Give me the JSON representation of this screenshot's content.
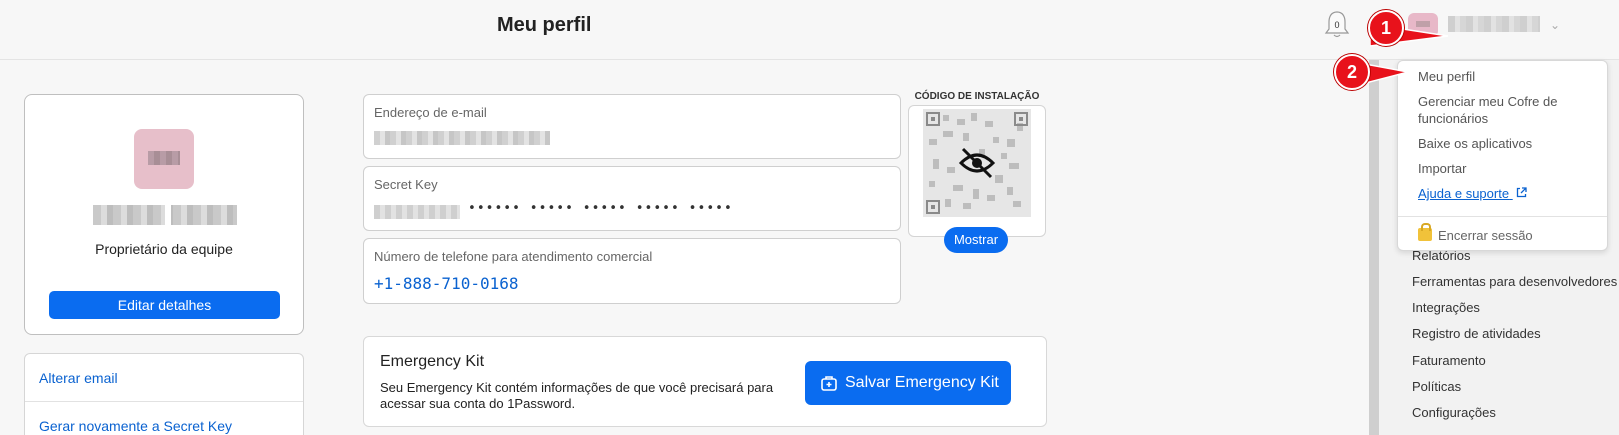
{
  "header": {
    "title": "Meu perfil",
    "notification_count": "0"
  },
  "callouts": [
    "1",
    "2"
  ],
  "profile": {
    "role": "Proprietário da equipe",
    "edit_label": "Editar detalhes"
  },
  "account_links": [
    "Alterar email",
    "Gerar novamente a Secret Key"
  ],
  "fields": {
    "email_label": "Endereço de e-mail",
    "secret_key_label": "Secret Key",
    "secret_key_masked": "•••••• ••••• ••••• ••••• •••••",
    "phone_label": "Número de telefone para atendimento comercial",
    "phone_value": "+1-888-710-0168"
  },
  "install_code": {
    "title": "CÓDIGO DE INSTALAÇÃO",
    "show_label": "Mostrar"
  },
  "emergency_kit": {
    "title": "Emergency Kit",
    "description": "Seu Emergency Kit contém informações de que você precisará para acessar sua conta do 1Password.",
    "button_label": "Salvar Emergency Kit"
  },
  "user_menu": {
    "items": [
      "Meu perfil",
      "Gerenciar meu Cofre de funcionários",
      "Baixe os aplicativos",
      "Importar"
    ],
    "help_label": "Ajuda e suporte",
    "logout_label": "Encerrar sessão"
  },
  "sidebar_nav": [
    "Relatórios",
    "Ferramentas para desenvolvedores",
    "Integrações",
    "Registro de atividades",
    "Faturamento",
    "Políticas",
    "Configurações"
  ],
  "colors": {
    "accent": "#0a6cf0",
    "link": "#0a62d0",
    "callout": "#e8121b"
  }
}
